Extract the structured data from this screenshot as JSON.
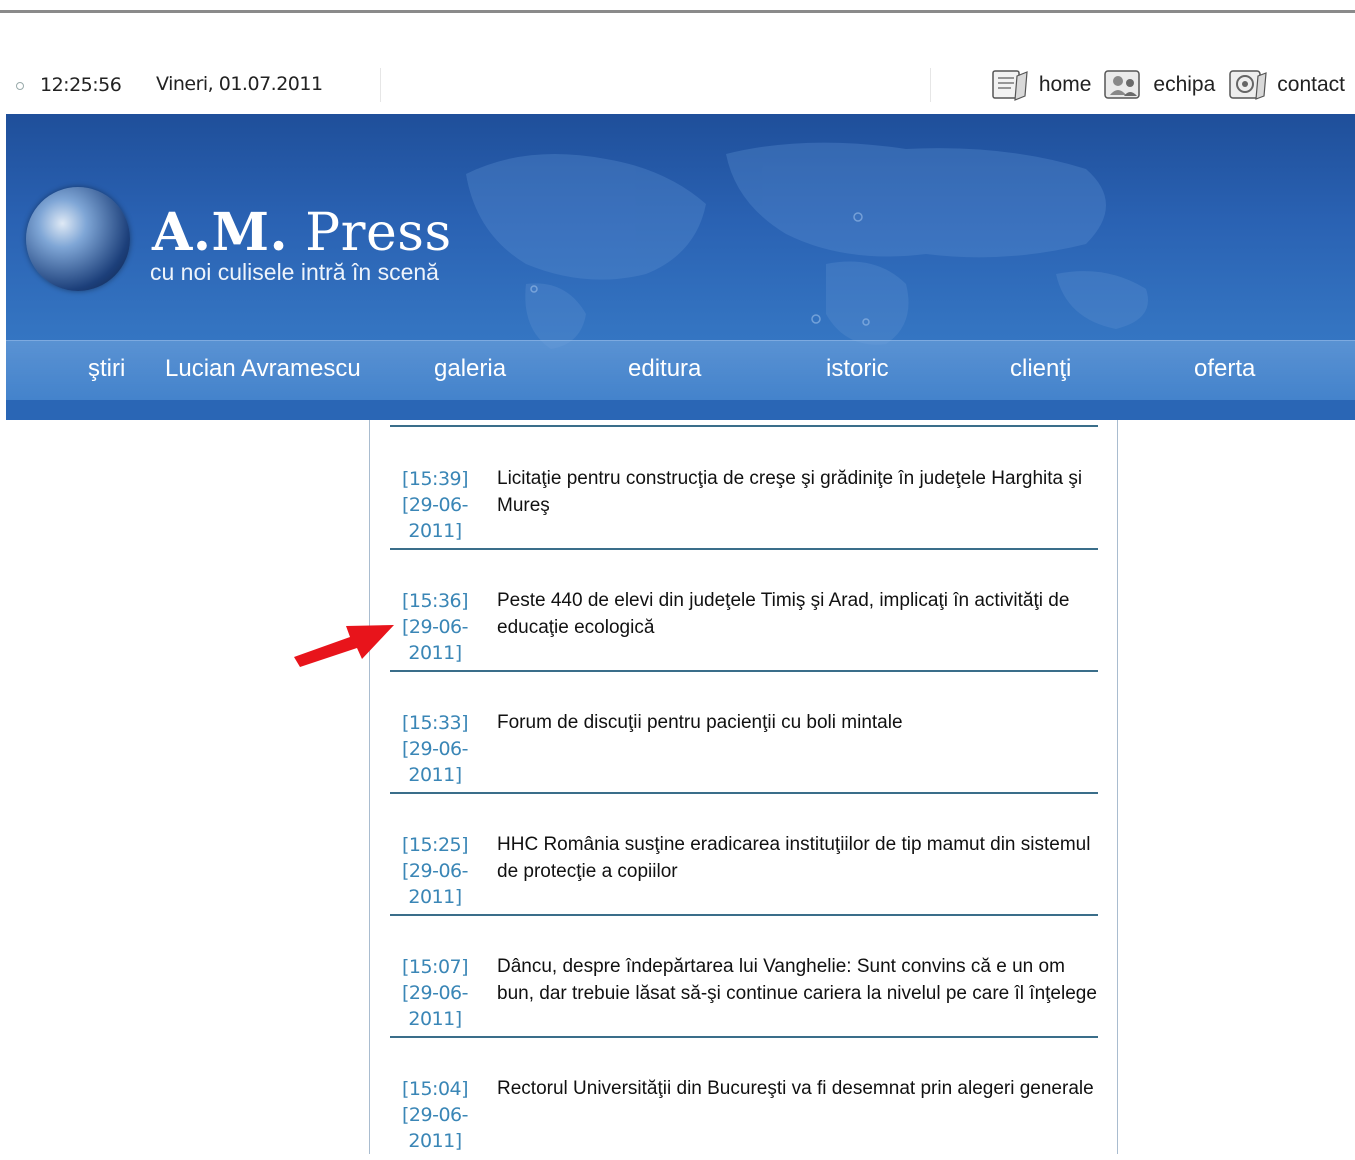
{
  "header": {
    "time": "12:25:56",
    "date": "Vineri, 01.07.2011",
    "links": [
      {
        "label": "home",
        "icon": "home-icon"
      },
      {
        "label": "echipa",
        "icon": "team-icon"
      },
      {
        "label": "contact",
        "icon": "contact-icon"
      }
    ]
  },
  "banner": {
    "logo_bold": "A.M.",
    "logo_rest": "Press",
    "slogan": "cu noi culisele intră în scenă"
  },
  "nav": [
    {
      "label": "ştiri"
    },
    {
      "label": "Lucian Avramescu"
    },
    {
      "label": "galeria"
    },
    {
      "label": "editura"
    },
    {
      "label": "istoric"
    },
    {
      "label": "clienţi"
    },
    {
      "label": "oferta"
    }
  ],
  "news": [
    {
      "time": "[15:39]",
      "date1": "[29-06-",
      "date2": "2011]",
      "title": "Licitaţie pentru construcţia de creşe şi grădiniţe în judeţele Harghita şi Mureş"
    },
    {
      "time": "[15:36]",
      "date1": "[29-06-",
      "date2": "2011]",
      "title": "Peste 440 de elevi din judeţele Timiş şi Arad, implicaţi în activităţi de educaţie ecologică"
    },
    {
      "time": "[15:33]",
      "date1": "[29-06-",
      "date2": "2011]",
      "title": "Forum de discuţii pentru pacienţii cu boli mintale"
    },
    {
      "time": "[15:25]",
      "date1": "[29-06-",
      "date2": "2011]",
      "title": "HHC România susţine eradicarea instituţiilor de tip mamut din sistemul de protecţie a copiilor"
    },
    {
      "time": "[15:07]",
      "date1": "[29-06-",
      "date2": "2011]",
      "title": "Dâncu, despre îndepărtarea lui Vanghelie: Sunt convins că e un om bun, dar trebuie lăsat să-şi continue cariera la nivelul pe care îl înţelege"
    },
    {
      "time": "[15:04]",
      "date1": "[29-06-",
      "date2": "2011]",
      "title": "Rectorul Universităţii din Bucureşti va fi desemnat prin alegeri generale"
    }
  ],
  "colors": {
    "banner": "#2a62b3",
    "timestamp": "#3a86b6",
    "divider": "#3a6e8a",
    "arrow": "#e8141b"
  }
}
